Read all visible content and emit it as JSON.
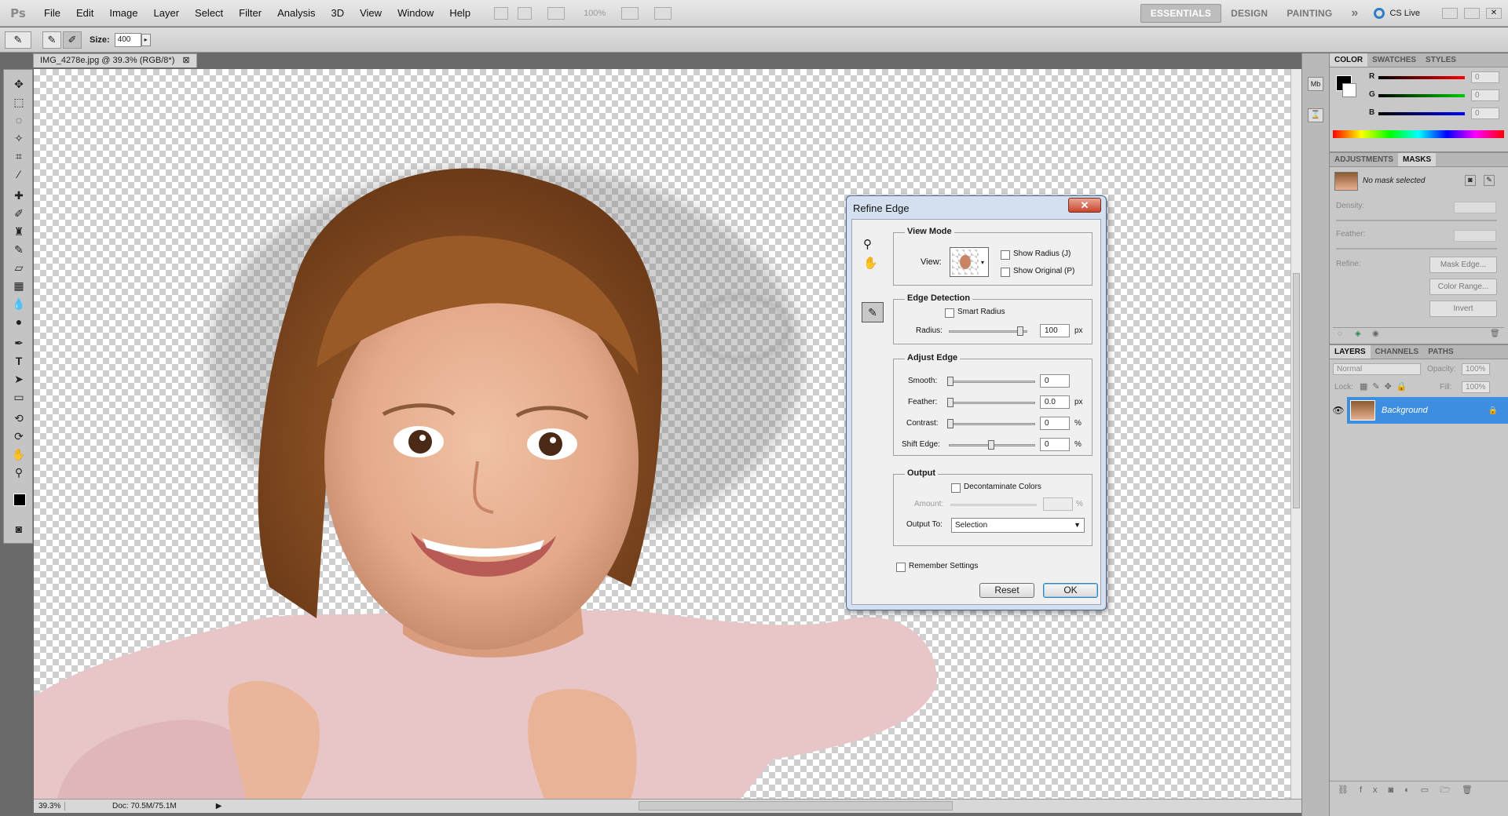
{
  "app": {
    "logo": "Ps"
  },
  "menu": [
    "File",
    "Edit",
    "Image",
    "Layer",
    "Select",
    "Filter",
    "Analysis",
    "3D",
    "View",
    "Window",
    "Help"
  ],
  "menubar_zoom": "100%",
  "workspaces": {
    "essentials": "ESSENTIALS",
    "design": "DESIGN",
    "painting": "PAINTING",
    "more": "»",
    "cslive": "CS Live"
  },
  "options": {
    "size_label": "Size:",
    "size_value": "400"
  },
  "document": {
    "tab": "IMG_4278e.jpg @ 39.3% (RGB/8*)",
    "zoom": "39.3%",
    "doc_info": "Doc: 70.5M/75.1M"
  },
  "color_panel": {
    "tabs": [
      "COLOR",
      "SWATCHES",
      "STYLES"
    ],
    "channels": [
      {
        "label": "R",
        "value": "0"
      },
      {
        "label": "G",
        "value": "0"
      },
      {
        "label": "B",
        "value": "0"
      }
    ],
    "foreground": "#000000",
    "background": "#ffffff"
  },
  "masks_panel": {
    "tabs": [
      "ADJUSTMENTS",
      "MASKS"
    ],
    "status": "No mask selected",
    "density_label": "Density:",
    "feather_label": "Feather:",
    "refine_label": "Refine:",
    "mask_edge": "Mask Edge...",
    "color_range": "Color Range...",
    "invert": "Invert"
  },
  "layers_panel": {
    "tabs": [
      "LAYERS",
      "CHANNELS",
      "PATHS"
    ],
    "blend_mode": "Normal",
    "opacity_label": "Opacity:",
    "opacity": "100%",
    "lock_label": "Lock:",
    "fill_label": "Fill:",
    "fill": "100%",
    "layer_name": "Background",
    "selected_color": "#3d8ee0"
  },
  "dialog": {
    "title": "Refine Edge",
    "close": "✕",
    "view_mode": {
      "title": "View Mode",
      "view_label": "View:",
      "show_radius": "Show Radius (J)",
      "show_original": "Show Original (P)"
    },
    "edge_detection": {
      "title": "Edge Detection",
      "smart_radius": "Smart Radius",
      "radius_label": "Radius:",
      "radius_value": "100",
      "radius_unit": "px",
      "radius_level": 0.93
    },
    "adjust_edge": {
      "title": "Adjust Edge",
      "rows": [
        {
          "label": "Smooth:",
          "value": "0",
          "unit": "",
          "level": 0
        },
        {
          "label": "Feather:",
          "value": "0.0",
          "unit": "px",
          "level": 0
        },
        {
          "label": "Contrast:",
          "value": "0",
          "unit": "%",
          "level": 0
        },
        {
          "label": "Shift Edge:",
          "value": "0",
          "unit": "%",
          "level": 0.5
        }
      ]
    },
    "output": {
      "title": "Output",
      "decontaminate": "Decontaminate Colors",
      "amount_label": "Amount:",
      "amount_unit": "%",
      "output_to_label": "Output To:",
      "output_to_value": "Selection"
    },
    "remember": "Remember Settings",
    "reset": "Reset",
    "ok": "OK"
  }
}
